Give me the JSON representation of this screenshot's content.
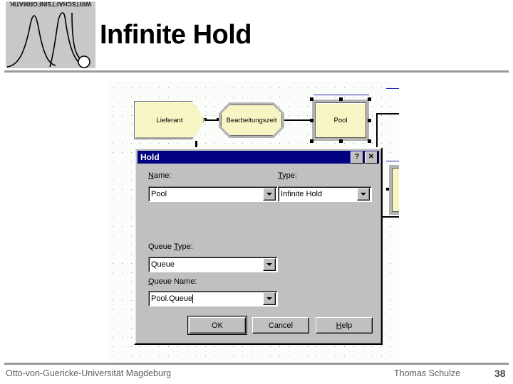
{
  "slide": {
    "title": "Infinite Hold",
    "logo_caption": "WIRTSCHAFTSINFORMATIK"
  },
  "footer": {
    "institution": "Otto-von-Guericke-Universität Magdeburg",
    "author": "Thomas Schulze",
    "page_number": "38"
  },
  "canvas": {
    "nodes": [
      {
        "label": "Lieferant",
        "shape": "pentagon",
        "selected": false
      },
      {
        "label": "Bearbeitungszeit",
        "shape": "octagon",
        "selected": false
      },
      {
        "label": "Pool",
        "shape": "rectangle",
        "selected": true
      },
      {
        "label": "",
        "shape": "rectangle-clipped",
        "selected": true
      }
    ]
  },
  "dialog": {
    "title": "Hold",
    "titlebar_buttons": [
      {
        "name": "help",
        "glyph": "?"
      },
      {
        "name": "close",
        "glyph": "✕"
      }
    ],
    "fields": {
      "name": {
        "label_prefix": "",
        "label_accel": "N",
        "label_rest": "ame:",
        "value": "Pool",
        "placeholder": ""
      },
      "type": {
        "label_prefix": "",
        "label_accel": "T",
        "label_rest": "ype:",
        "value": "Infinite Hold",
        "placeholder": ""
      },
      "queue_type": {
        "label_prefix": "Queue ",
        "label_accel": "T",
        "label_rest": "ype:",
        "value": "Queue",
        "placeholder": ""
      },
      "queue_name": {
        "label_prefix": "",
        "label_accel": "Q",
        "label_rest": "ueue Name:",
        "value": "Pool.Queue",
        "placeholder": ""
      }
    },
    "buttons": {
      "ok": {
        "label": "OK",
        "accel": "",
        "default": true
      },
      "cancel": {
        "label": "Cancel",
        "accel": ""
      },
      "help": {
        "label_prefix": "",
        "accel": "H",
        "label_rest": "elp"
      }
    }
  },
  "colors": {
    "titlebar": "#000080",
    "dialog_face": "#c0c0c0",
    "node_fill": "#f7f5c3",
    "canvas_bg": "#fbfdfb",
    "rule": "#9a9a9a"
  }
}
